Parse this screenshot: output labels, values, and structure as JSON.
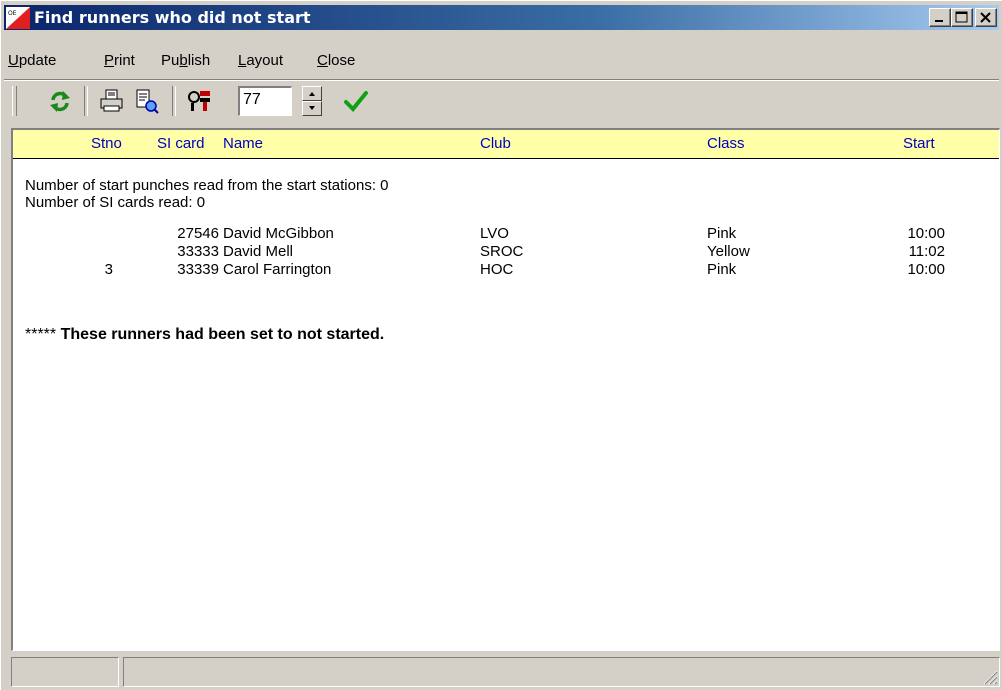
{
  "window": {
    "title": "Find runners who did not start"
  },
  "menu": {
    "items": [
      {
        "label": "Update",
        "accel": "U"
      },
      {
        "label": "Print",
        "accel": "P"
      },
      {
        "label": "Publish",
        "accel": "b"
      },
      {
        "label": "Layout",
        "accel": "L"
      },
      {
        "label": "Close",
        "accel": "C"
      }
    ]
  },
  "toolbar": {
    "number_value": "77",
    "icons": [
      "refresh-icon",
      "print-icon",
      "print-preview-icon",
      "settings-icon",
      "checkmark-icon"
    ]
  },
  "table": {
    "headers": {
      "stno": "Stno",
      "sicard": "SI card",
      "name": "Name",
      "club": "Club",
      "class": "Class",
      "start": "Start"
    },
    "info_lines": [
      "Number of start punches read from the start stations: 0",
      "Number of SI cards read: 0"
    ],
    "rows": [
      {
        "stno": "",
        "sicard": "27546",
        "name": "David McGibbon",
        "club": "LVO",
        "class": "Pink",
        "start": "10:00"
      },
      {
        "stno": "",
        "sicard": "33333",
        "name": "David Mell",
        "club": "SROC",
        "class": "Yellow",
        "start": "11:02"
      },
      {
        "stno": "3",
        "sicard": "33339",
        "name": "Carol Farrington",
        "club": "HOC",
        "class": "Pink",
        "start": "10:00"
      }
    ],
    "note_prefix": "*****",
    "note_text": "These runners had been set to not started."
  },
  "colors": {
    "title_gradient_start": "#0a246a",
    "title_gradient_end": "#a6caf0",
    "header_background": "#ffffa8",
    "header_text": "#0000c0",
    "window_face": "#d4d0c8"
  }
}
